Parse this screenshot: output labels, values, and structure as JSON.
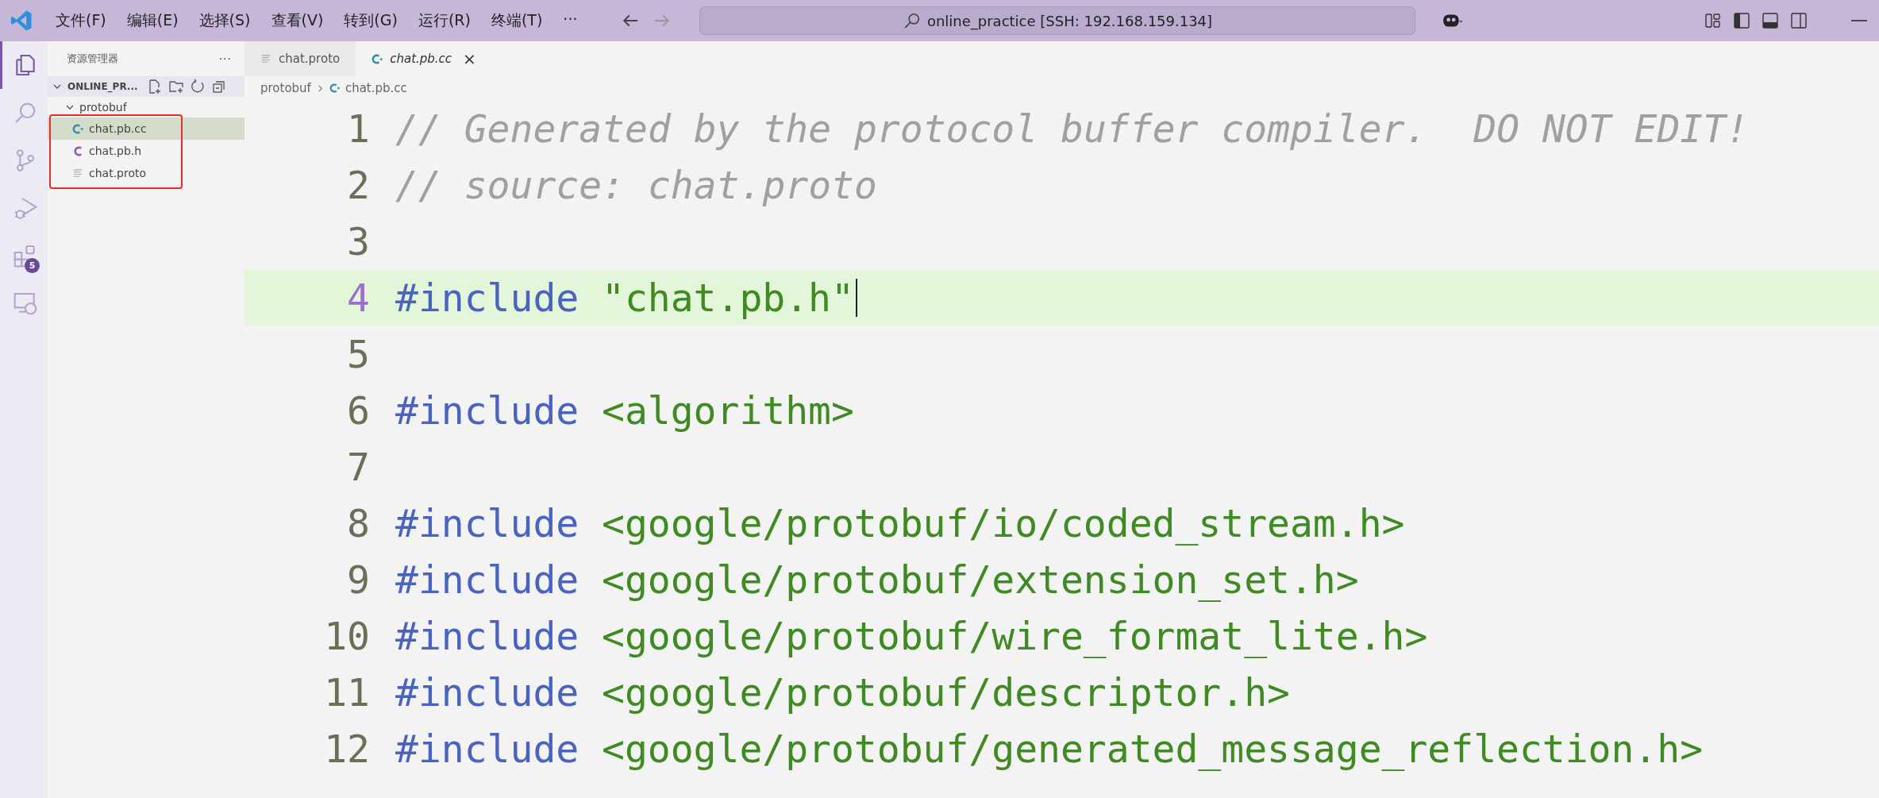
{
  "menu": [
    "文件(F)",
    "编辑(E)",
    "选择(S)",
    "查看(V)",
    "转到(G)",
    "运行(R)",
    "终端(T)",
    "···"
  ],
  "command_center": {
    "text": "online_practice [SSH: 192.168.159.134]"
  },
  "activity_bar": [
    {
      "kind": "files",
      "selected": true
    },
    {
      "kind": "search",
      "selected": false
    },
    {
      "kind": "scm",
      "selected": false
    },
    {
      "kind": "debug",
      "selected": false
    },
    {
      "kind": "extensions",
      "selected": false,
      "badge": "5"
    },
    {
      "kind": "remote",
      "selected": false
    }
  ],
  "sidebar": {
    "title": "资源管理器",
    "more": "···",
    "project": "ONLINE_PR...",
    "tree": [
      {
        "label": "protobuf",
        "expanded": true,
        "children": [
          {
            "label": "chat.pb.cc",
            "kind": "cpp",
            "selected": true
          },
          {
            "label": "chat.pb.h",
            "kind": "c",
            "selected": false
          },
          {
            "label": "chat.proto",
            "kind": "text",
            "selected": false
          }
        ]
      }
    ]
  },
  "tabs": [
    {
      "label": "chat.proto",
      "kind": "text",
      "selected": false
    },
    {
      "label": "chat.pb.cc",
      "kind": "cpp",
      "selected": true,
      "close": "×"
    }
  ],
  "breadcrumb": [
    {
      "label": "protobuf",
      "kind": "folder"
    },
    {
      "label": "chat.pb.cc",
      "kind": "cpp"
    }
  ],
  "editor": {
    "lines": [
      {
        "number": "1",
        "current": false,
        "tokens": [
          {
            "kind": "comment",
            "text": "// Generated by the protocol buffer compiler.  DO NOT EDIT!"
          }
        ]
      },
      {
        "number": "2",
        "current": false,
        "tokens": [
          {
            "kind": "comment",
            "text": "// source: chat.proto"
          }
        ]
      },
      {
        "number": "3",
        "current": false
      },
      {
        "number": "4",
        "current": true,
        "tokens": [
          {
            "kind": "keyword",
            "text": "#include"
          },
          {
            "kind": "string",
            "text": "\"chat.pb.h\""
          }
        ]
      },
      {
        "number": "5",
        "current": false
      },
      {
        "number": "6",
        "current": false,
        "tokens": [
          {
            "kind": "keyword",
            "text": "#include"
          },
          {
            "kind": "string",
            "text": "<algorithm>"
          }
        ]
      },
      {
        "number": "7",
        "current": false
      },
      {
        "number": "8",
        "current": false,
        "tokens": [
          {
            "kind": "keyword",
            "text": "#include"
          },
          {
            "kind": "string",
            "text": "<google/protobuf/io/coded_stream.h>"
          }
        ]
      },
      {
        "number": "9",
        "current": false,
        "tokens": [
          {
            "kind": "keyword",
            "text": "#include"
          },
          {
            "kind": "string",
            "text": "<google/protobuf/extension_set.h>"
          }
        ]
      },
      {
        "number": "10",
        "current": false,
        "tokens": [
          {
            "kind": "keyword",
            "text": "#include"
          },
          {
            "kind": "string",
            "text": "<google/protobuf/wire_format_lite.h>"
          }
        ]
      },
      {
        "number": "11",
        "current": false,
        "tokens": [
          {
            "kind": "keyword",
            "text": "#include"
          },
          {
            "kind": "string",
            "text": "<google/protobuf/descriptor.h>"
          }
        ]
      },
      {
        "number": "12",
        "current": false,
        "tokens": [
          {
            "kind": "keyword",
            "text": "#include"
          },
          {
            "kind": "string",
            "text": "<google/protobuf/generated_message_reflection.h>"
          }
        ]
      }
    ]
  }
}
